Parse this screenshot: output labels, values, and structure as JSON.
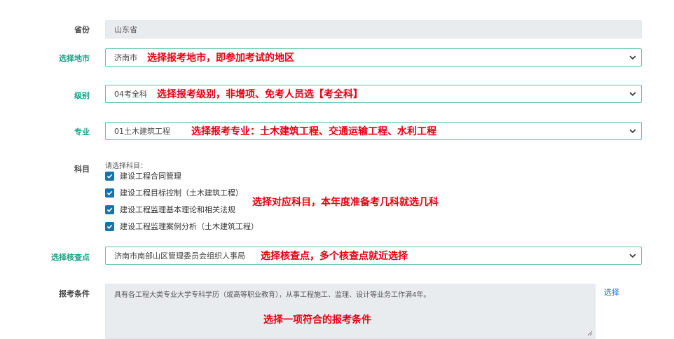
{
  "province": {
    "label": "省份",
    "value": "山东省"
  },
  "city": {
    "label": "选择地市",
    "value": "济南市",
    "annotation": "选择报考地市，即参加考试的地区"
  },
  "level": {
    "label": "级别",
    "value": "04考全科",
    "annotation": "选择报考级别，非增项、免考人员选【考全科】"
  },
  "major": {
    "label": "专业",
    "value": "01土木建筑工程",
    "annotation": "选择报考专业：土木建筑工程、交通运输工程、水利工程"
  },
  "subjects": {
    "label": "科目",
    "hint": "请选择科目：",
    "items": [
      {
        "text": "建设工程合同管理",
        "checked": true
      },
      {
        "text": "建设工程目标控制（土木建筑工程）",
        "checked": true
      },
      {
        "text": "建设工程监理基本理论和相关法规",
        "checked": true
      },
      {
        "text": "建设工程监理案例分析（土木建筑工程）",
        "checked": true
      }
    ],
    "annotation": "选择对应科目，本年度准备考几科就选几科"
  },
  "checkpoint": {
    "label": "选择核查点",
    "value": "济南市南部山区管理委员会组织人事局",
    "annotation": "选择核查点，多个核查点就近选择"
  },
  "conditions": {
    "label": "报考条件",
    "value": "具有各工程大类专业大学专科学历（或高等职业教育），从事工程施工、监理、设计等业务工作满4年。",
    "annotation": "选择一项符合的报考条件",
    "select_link": "选择"
  },
  "colors": {
    "accent": "#1aa086",
    "annotation": "#e60012",
    "checkbox": "#1a73a8",
    "link": "#1a73c8"
  }
}
